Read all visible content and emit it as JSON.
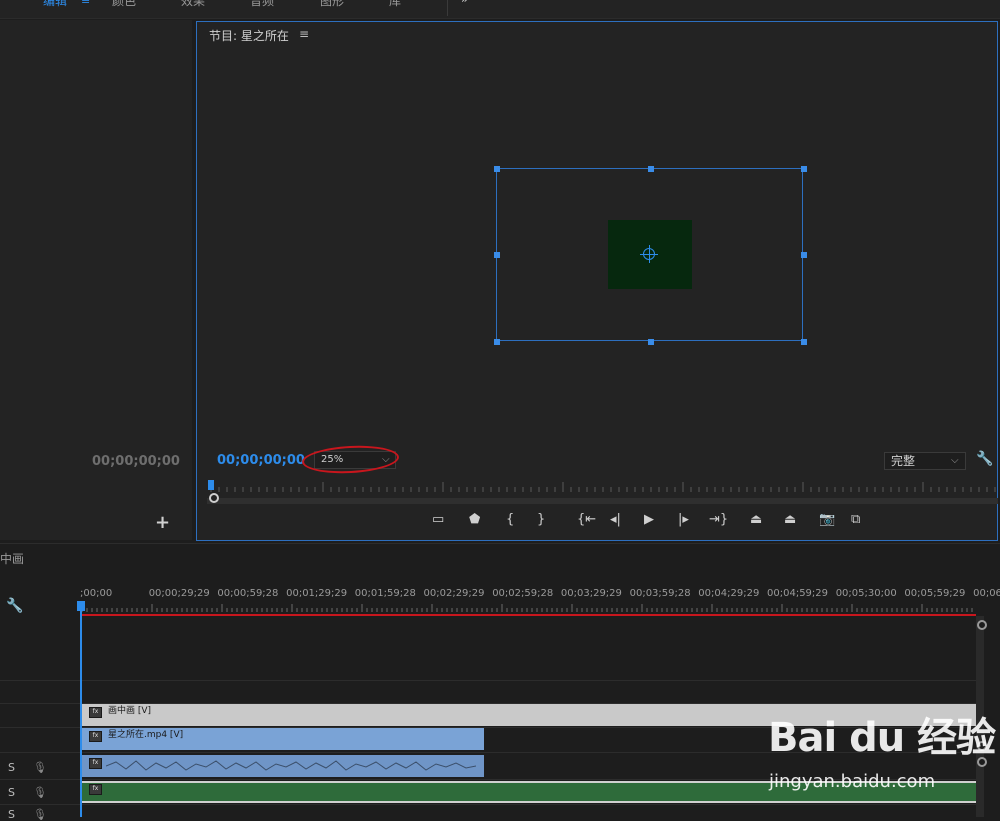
{
  "workspace_tabs": [
    {
      "label": "编辑",
      "active": true
    },
    {
      "label": "颜色",
      "active": false
    },
    {
      "label": "效果",
      "active": false
    },
    {
      "label": "音频",
      "active": false
    },
    {
      "label": "图形",
      "active": false
    },
    {
      "label": "库",
      "active": false
    }
  ],
  "workspace_overflow": "»",
  "left_panel": {
    "timecode": "00;00;00;00",
    "add_label": "+"
  },
  "program_monitor": {
    "title": "节目: 星之所在",
    "menu_icon": "≡",
    "timecode": "00;00;00;00",
    "zoom": "25%",
    "quality": "完整",
    "transport": [
      "marker-icon",
      "in-icon",
      "out-icon",
      "go-to-in-icon",
      "step-back-icon",
      "play-icon",
      "step-forward-icon",
      "go-to-out-icon",
      "lift-icon",
      "extract-icon",
      "export-frame-icon",
      "compare-icon"
    ]
  },
  "timeline": {
    "title": "中画",
    "ruler_labels": [
      ";00;00",
      "00;00;29;29",
      "00;00;59;28",
      "00;01;29;29",
      "00;01;59;28",
      "00;02;29;29",
      "00;02;59;28",
      "00;03;29;29",
      "00;03;59;28",
      "00;04;29;29",
      "00;04;59;29",
      "00;05;30;00",
      "00;05;59;29",
      "00;06;"
    ],
    "clips": {
      "v2": "画中画 [V]",
      "v1": "星之所在.mp4 [V]"
    },
    "audio_tracks": [
      {
        "solo": "S"
      },
      {
        "solo": "S"
      },
      {
        "solo": "S"
      }
    ]
  },
  "watermark": {
    "brand": "Bai du 经验",
    "url": "jingyan.baidu.com"
  },
  "colors": {
    "accent": "#2d8ceb",
    "video_clip": "#7aa3d6",
    "nested_clip": "#c9c9c9",
    "audio_clip": "#6f95c7",
    "green_clip": "#2e6b3a",
    "annotation": "#c8161d"
  }
}
